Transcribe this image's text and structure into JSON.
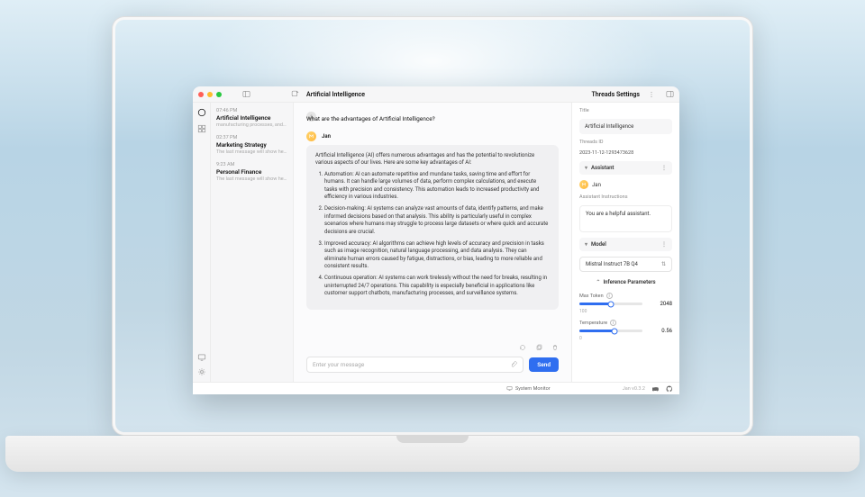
{
  "titlebar": {
    "title": "Artificial Intelligence",
    "settings_label": "Threads Settings"
  },
  "traffic_lights": {
    "red": "#ff5f57",
    "yellow": "#febc2e",
    "green": "#28c840"
  },
  "threads": [
    {
      "time": "07:46 PM",
      "title": "Artificial Intelligence",
      "preview": "manufacturing processes, and s..."
    },
    {
      "time": "02:37 PM",
      "title": "Marketing Strategy",
      "preview": "The last message will show here"
    },
    {
      "time": "9:23 AM",
      "title": "Personal Finance",
      "preview": "The last message will show here"
    }
  ],
  "chat": {
    "user_question": "What are the advantages of Artificial Intelligence?",
    "bot_name": "Jan",
    "bot_intro": "Artificial Intelligence (AI) offers numerous advantages and has the potential to revolutionize various aspects of our lives. Here are some key advantages of AI:",
    "bot_points": [
      "Automation: AI can automate repetitive and mundane tasks, saving time and effort for humans. It can handle large volumes of data, perform complex calculations, and execute tasks with precision and consistency. This automation leads to increased productivity and efficiency in various industries.",
      "Decision-making: AI systems can analyze vast amounts of data, identify patterns, and make informed decisions based on that analysis. This ability is particularly useful in complex scenarios where humans may struggle to process large datasets or where quick and accurate decisions are crucial.",
      "Improved accuracy: AI algorithms can achieve high levels of accuracy and precision in tasks such as image recognition, natural language processing, and data analysis. They can eliminate human errors caused by fatigue, distractions, or bias, leading to more reliable and consistent results.",
      "Continuous operation: AI systems can work tirelessly without the need for breaks, resulting in uninterrupted 24/7 operations. This capability is especially beneficial in applications like customer support chatbots, manufacturing processes, and surveillance systems."
    ],
    "composer_placeholder": "Enter your message",
    "send_label": "Send"
  },
  "settings": {
    "title_label": "Title",
    "title_value": "Artificial Intelligence",
    "threads_id_label": "Threads ID",
    "threads_id_value": "2023-11-12-1293473628",
    "assistant_section": "Assistant",
    "assistant_name": "Jan",
    "instructions_label": "Assistant Instructions",
    "instructions_value": "You are a helpful assistant.",
    "model_section": "Model",
    "model_value": "Mistral Instruct 7B Q4",
    "params_header": "Inference Parameters",
    "max_token_label": "Max Token",
    "max_token_value": "2048",
    "max_token_min": "100",
    "max_token_max": "",
    "temperature_label": "Temperature",
    "temperature_value": "0.56",
    "temperature_min": "0",
    "temperature_max": ""
  },
  "statusbar": {
    "system_monitor": "System Monitor",
    "version": "Jan v0.3.2"
  }
}
